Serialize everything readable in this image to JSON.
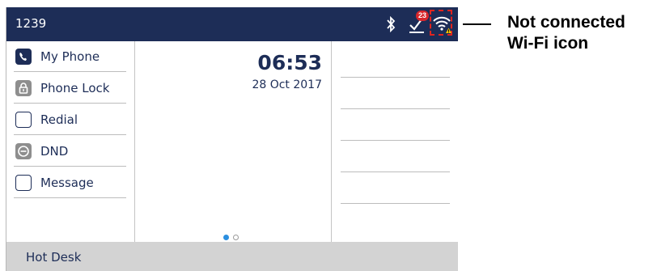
{
  "status_bar": {
    "extension": "1239",
    "voicemail_count": "23",
    "icons": [
      "bluetooth-icon",
      "voicemail-icon",
      "wifi-not-connected-icon"
    ]
  },
  "softkeys": [
    {
      "label": "My Phone",
      "icon": "phone-icon"
    },
    {
      "label": "Phone Lock",
      "icon": "lock-icon"
    },
    {
      "label": "Redial",
      "icon": "blank-key-icon"
    },
    {
      "label": "DND",
      "icon": "dnd-icon"
    },
    {
      "label": "Message",
      "icon": "blank-key-icon"
    }
  ],
  "idle": {
    "time": "06:53",
    "date": "28 Oct 2017"
  },
  "pager": {
    "pages": 2,
    "current": 1
  },
  "bottom_bar": {
    "label": "Hot Desk"
  },
  "callout": {
    "line1": "Not connected",
    "line2": "Wi-Fi icon"
  },
  "colors": {
    "header": "#1d2d57",
    "highlight_box": "#e0241f",
    "badge": "#d9262b",
    "footer": "#d3d3d3"
  }
}
